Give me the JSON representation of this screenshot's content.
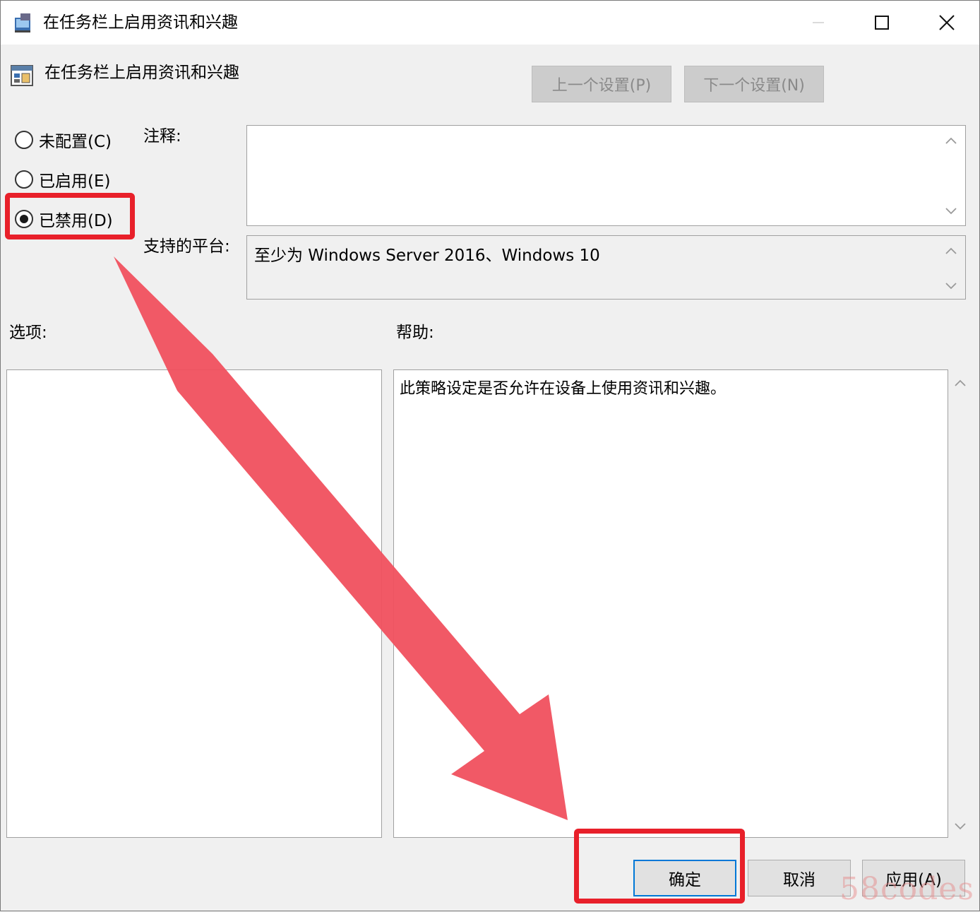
{
  "window": {
    "title": "在任务栏上启用资讯和兴趣"
  },
  "header": {
    "policy_name": "在任务栏上启用资讯和兴趣",
    "prev_setting": "上一个设置(P)",
    "next_setting": "下一个设置(N)"
  },
  "state": {
    "options": [
      {
        "label": "未配置(C)",
        "checked": false
      },
      {
        "label": "已启用(E)",
        "checked": false
      },
      {
        "label": "已禁用(D)",
        "checked": true
      }
    ]
  },
  "fields": {
    "comment_label": "注释:",
    "comment_value": "",
    "platform_label": "支持的平台:",
    "platform_value": "至少为 Windows Server 2016、Windows 10",
    "options_label": "选项:",
    "help_label": "帮助:",
    "help_text": "此策略设定是否允许在设备上使用资讯和兴趣。"
  },
  "buttons": {
    "ok": "确定",
    "cancel": "取消",
    "apply": "应用(A)"
  },
  "annotation": {
    "color": "#e8202a",
    "arrow_color": "#f0505e"
  },
  "watermark": "58codes"
}
